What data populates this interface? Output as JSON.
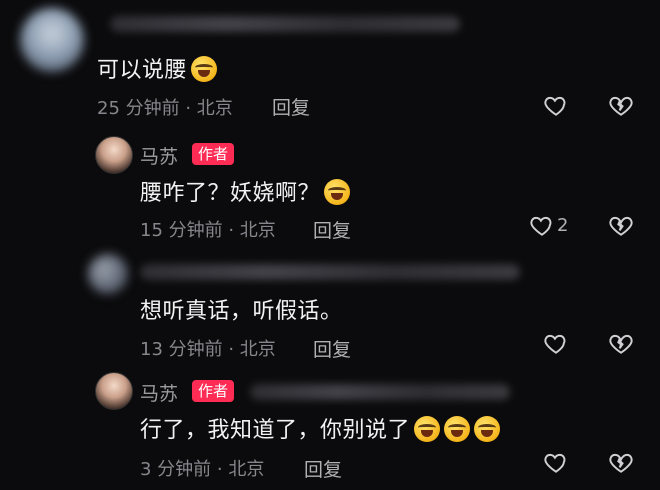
{
  "comments": [
    {
      "text": "可以说腰",
      "emoji_count": 1,
      "meta": "25 分钟前 · 北京",
      "reply": "回复"
    },
    {
      "author": "马苏",
      "badge": "作者",
      "text": "腰咋了？妖娆啊？",
      "emoji_count": 1,
      "meta": "15 分钟前 · 北京",
      "reply": "回复",
      "likes": "2"
    },
    {
      "text": "想听真话，听假话。",
      "meta": "13 分钟前 · 北京",
      "reply": "回复"
    },
    {
      "author": "马苏",
      "badge": "作者",
      "text": "行了，我知道了，你别说了",
      "emoji_count": 3,
      "meta": "3 分钟前 · 北京",
      "reply": "回复"
    }
  ],
  "icons": {
    "like": "heart-outline-icon",
    "dislike": "broken-heart-icon",
    "emoji": "rolling-laughing-emoji"
  },
  "colors": {
    "background": "#0b0b0d",
    "author_badge": "#fe2c55",
    "meta_text": "#86868c"
  }
}
